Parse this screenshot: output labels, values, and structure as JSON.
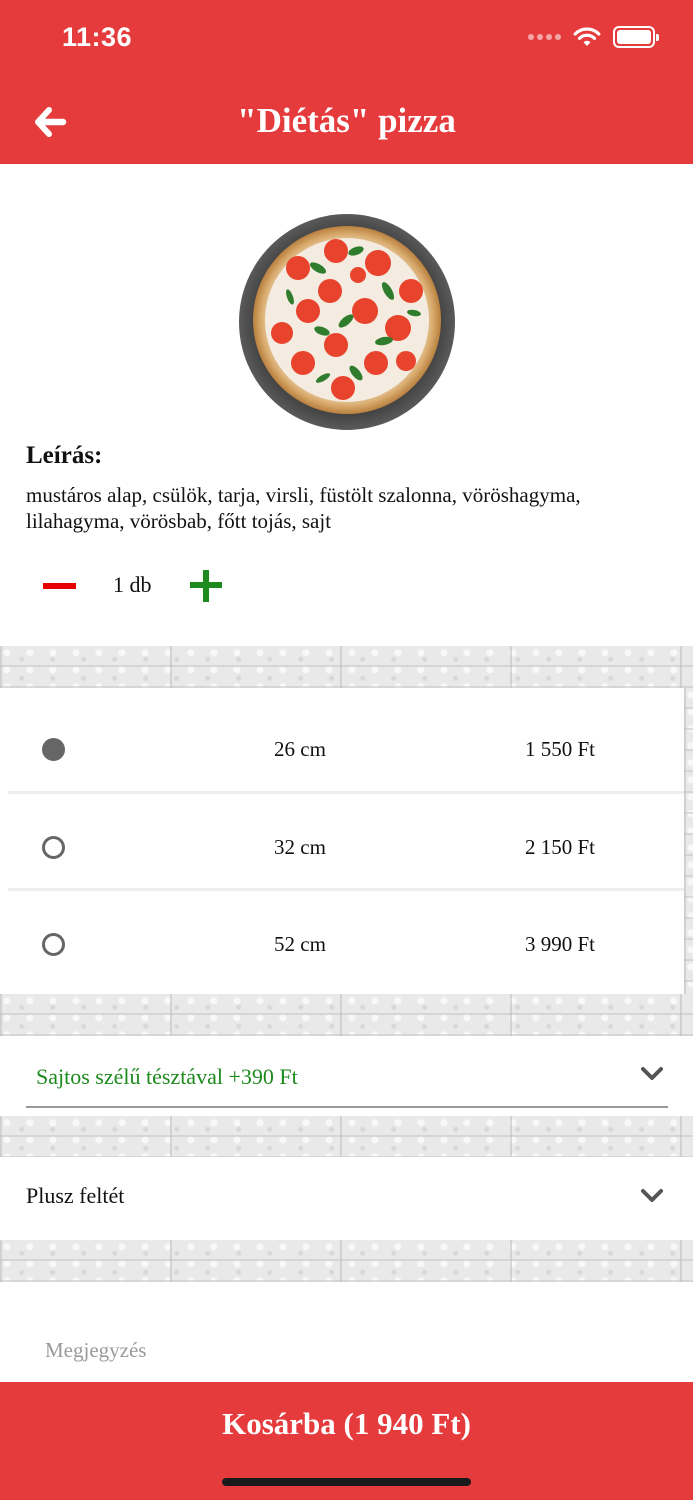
{
  "status_bar": {
    "time": "11:36"
  },
  "header": {
    "title": "\"Diétás\" pizza",
    "back_icon": "arrow-left-icon"
  },
  "product": {
    "image_alt": "pizza",
    "description_title": "Leírás:",
    "description": "mustáros alap, csülök, tarja, virsli, füstölt szalonna, vöröshagyma, lilahagyma, vörösbab, főtt tojás, sajt"
  },
  "quantity": {
    "value": "1 db",
    "minus_icon": "minus-icon",
    "plus_icon": "plus-icon"
  },
  "sizes": [
    {
      "size": "26 cm",
      "price": "1 550 Ft",
      "selected": true
    },
    {
      "size": "32 cm",
      "price": "2 150 Ft",
      "selected": false
    },
    {
      "size": "52 cm",
      "price": "3 990 Ft",
      "selected": false
    }
  ],
  "crust_select": {
    "value": "Sajtos szélű tésztával +390 Ft",
    "color": "#1c8a1c"
  },
  "extras_select": {
    "value": "Plusz feltét"
  },
  "note": {
    "placeholder": "Megjegyzés",
    "value": ""
  },
  "cart_button": {
    "label": "Kosárba (1 940 Ft)"
  },
  "colors": {
    "brand_red": "#e63b3c",
    "minus_red": "#e60000",
    "plus_green": "#1c8a1c",
    "radio_gray": "#666666"
  }
}
